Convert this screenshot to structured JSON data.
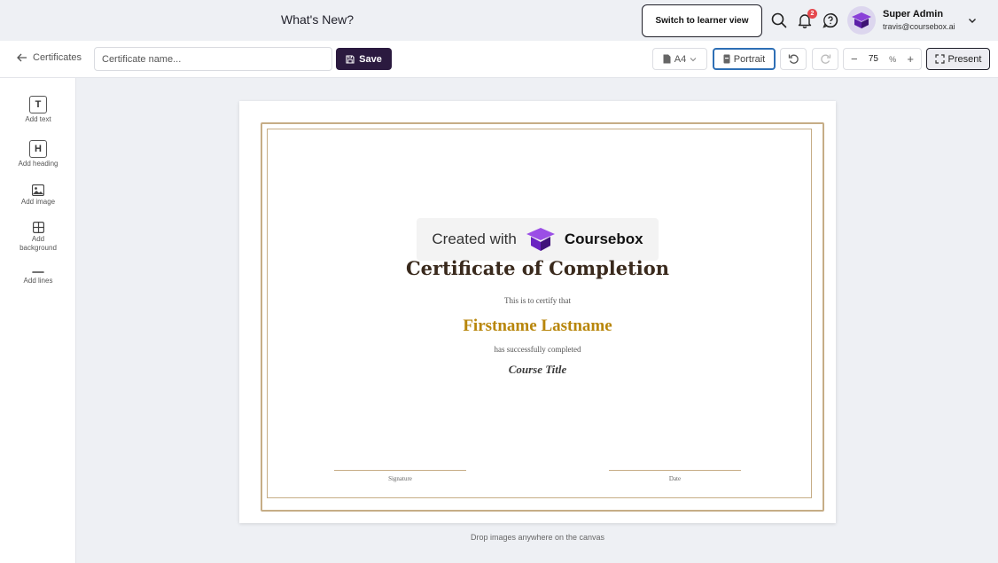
{
  "header": {
    "whats_new": "What's New?",
    "learner_view_button": "Switch to learner view",
    "notification_count": "2",
    "user_name": "Super Admin",
    "user_email": "travis@coursebox.ai"
  },
  "toolbar": {
    "back_label": "Certificates",
    "name_placeholder": "Certificate name...",
    "save_label": "Save",
    "paper_size": "A4",
    "orientation": "Portrait",
    "zoom_value": "75",
    "zoom_unit": "%",
    "present_label": "Present"
  },
  "sidebar": {
    "items": [
      {
        "label": "Add text",
        "icon": "T"
      },
      {
        "label": "Add heading",
        "icon": "H"
      },
      {
        "label": "Add image"
      },
      {
        "label": "Add background"
      },
      {
        "label": "Add lines"
      }
    ]
  },
  "certificate": {
    "watermark_prefix": "Created with",
    "watermark_brand": "Coursebox",
    "title": "Certificate of Completion",
    "certify_text": "This is to certify that",
    "recipient": "Firstname Lastname",
    "completed_text": "has successfully completed",
    "course_title": "Course Title",
    "signature_label": "Signature",
    "date_label": "Date"
  },
  "canvas_hint": "Drop images anywhere on the canvas",
  "colors": {
    "accent_dark": "#2b1a3f",
    "gold": "#b8860b",
    "border_gold": "#c6ad86",
    "notification": "#e5484d",
    "portrait_border": "#2e6fb5"
  }
}
